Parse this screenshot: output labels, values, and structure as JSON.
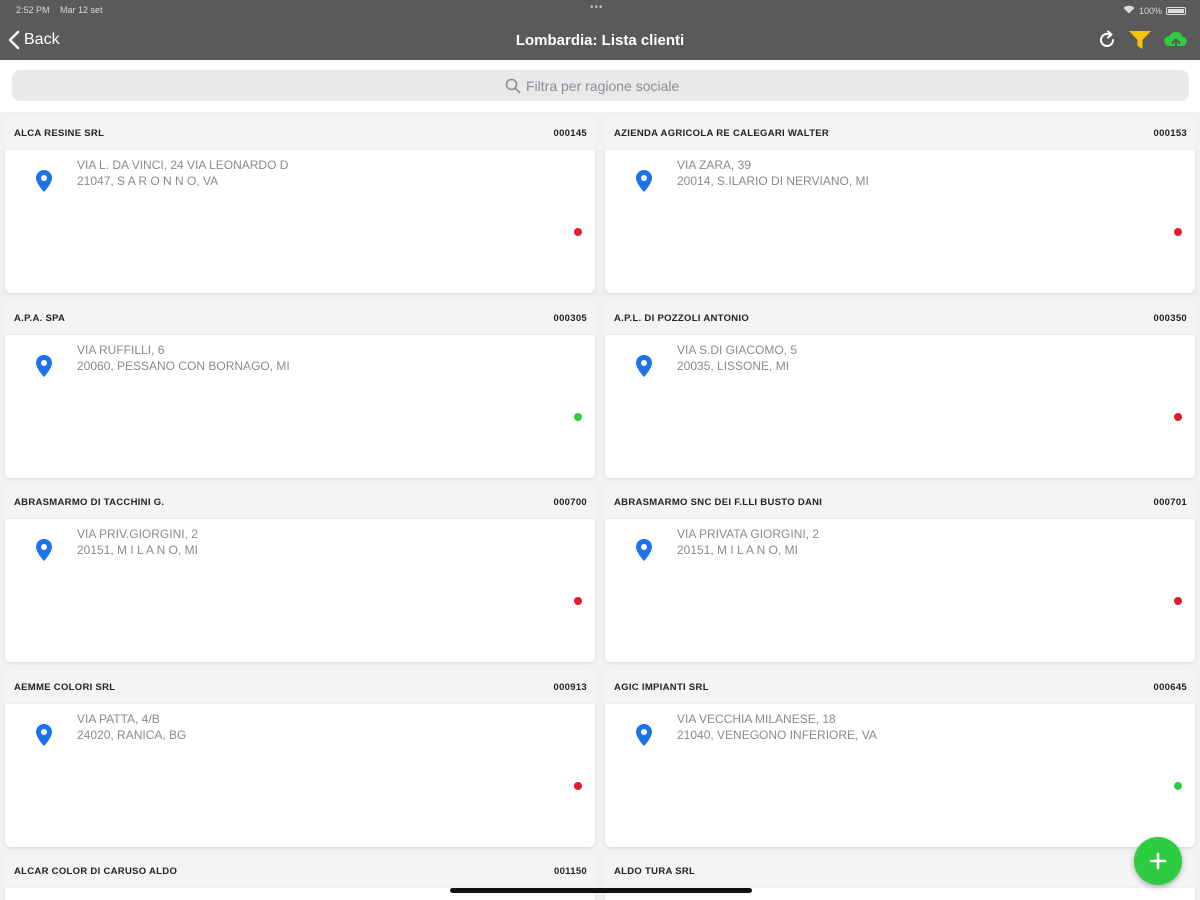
{
  "status_bar": {
    "time": "2:52 PM",
    "date": "Mar 12 set",
    "battery": "100%"
  },
  "nav": {
    "back_label": "Back",
    "title": "Lombardia: Lista clienti"
  },
  "search": {
    "placeholder": "Filtra per ragione sociale"
  },
  "colors": {
    "accent": "#1a73e8",
    "status_red": "#e8192c",
    "status_green": "#2ecc40",
    "filter_yellow": "#f5c400",
    "fab_green": "#2ecc40"
  },
  "clients": [
    {
      "name": "ALCA RESINE SRL",
      "code": "000145",
      "address1": "VIA L. DA VINCI, 24 VIA LEONARDO D",
      "address2": "21047, S A R O N N O, VA",
      "status": "red"
    },
    {
      "name": "AZIENDA AGRICOLA RE CALEGARI WALTER",
      "code": "000153",
      "address1": "VIA ZARA, 39",
      "address2": "20014, S.ILARIO DI NERVIANO, MI",
      "status": "red"
    },
    {
      "name": "A.P.A. SPA",
      "code": "000305",
      "address1": "VIA RUFFILLI, 6",
      "address2": "20060, PESSANO CON BORNAGO, MI",
      "status": "green"
    },
    {
      "name": "A.P.L. DI POZZOLI ANTONIO",
      "code": "000350",
      "address1": "VIA S.DI GIACOMO, 5",
      "address2": "20035, LISSONE, MI",
      "status": "red"
    },
    {
      "name": "ABRASMARMO DI TACCHINI G.",
      "code": "000700",
      "address1": "VIA PRIV.GIORGINI, 2",
      "address2": "20151, M I L A N O, MI",
      "status": "red"
    },
    {
      "name": "ABRASMARMO SNC DEI F.LLI BUSTO DANI",
      "code": "000701",
      "address1": "VIA PRIVATA GIORGINI, 2",
      "address2": "20151, M I L A N O, MI",
      "status": "red"
    },
    {
      "name": "AEMME COLORI SRL",
      "code": "000913",
      "address1": "VIA PATTA, 4/B",
      "address2": "24020, RANICA, BG",
      "status": "red"
    },
    {
      "name": "AGIC IMPIANTI SRL",
      "code": "000645",
      "address1": "VIA VECCHIA MILANESE, 18",
      "address2": "21040, VENEGONO INFERIORE, VA",
      "status": "green"
    },
    {
      "name": "ALCAR COLOR DI CARUSO ALDO",
      "code": "001150",
      "address1": "",
      "address2": "",
      "status": ""
    },
    {
      "name": "ALDO TURA SRL",
      "code": "",
      "address1": "",
      "address2": "",
      "status": ""
    }
  ]
}
